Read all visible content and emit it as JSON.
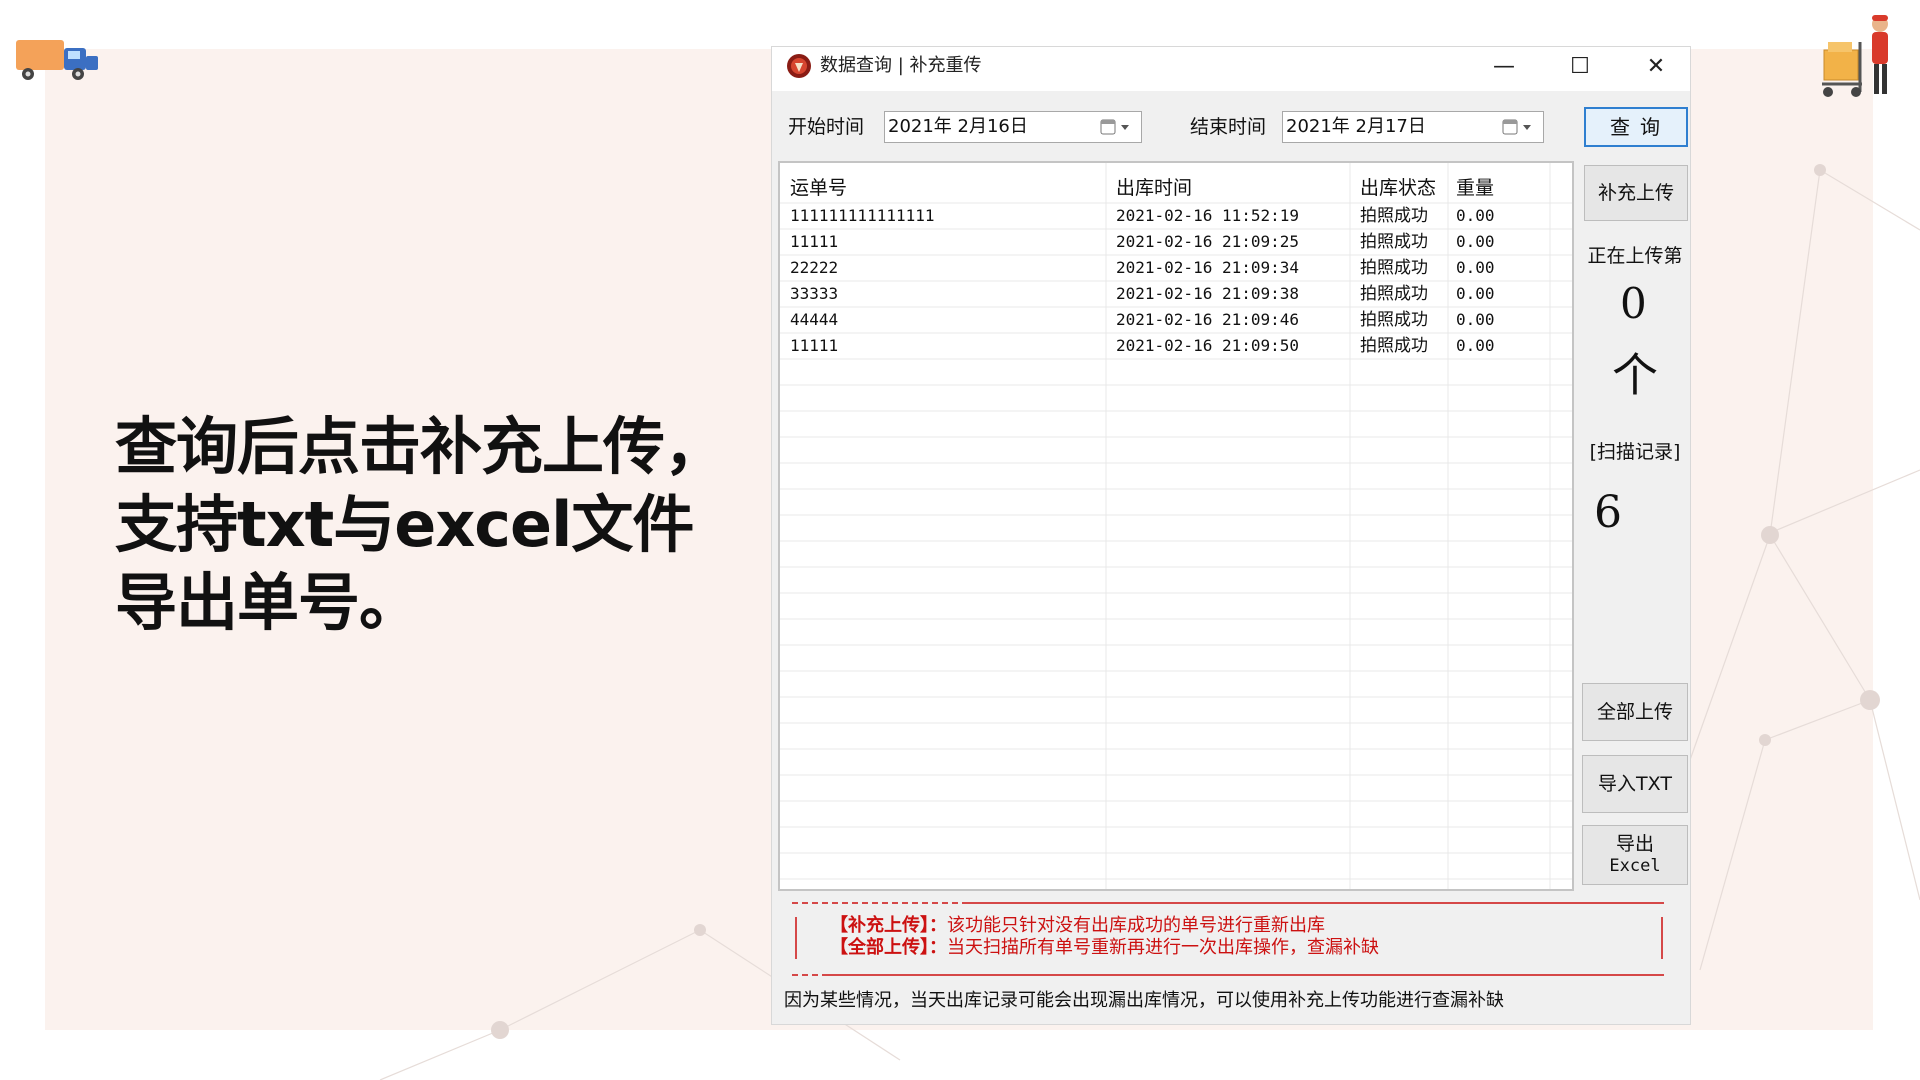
{
  "slide": {
    "heading_lines": [
      "查询后点击补充上传，",
      "支持txt与excel文件",
      "导出单号。"
    ]
  },
  "window": {
    "title": "数据查询 | 补充重传",
    "controls": {
      "minimize": "—",
      "maximize": "☐",
      "close": "✕"
    }
  },
  "filters": {
    "start_label": "开始时间",
    "start_value": "2021年 2月16日",
    "end_label": "结束时间",
    "end_value": "2021年 2月17日",
    "query_button": "查询"
  },
  "table": {
    "columns": [
      "运单号",
      "出库时间",
      "出库状态",
      "重量"
    ],
    "rows": [
      {
        "tracking": "111111111111111",
        "time": "2021-02-16 11:52:19",
        "status": "拍照成功",
        "weight": "0.00"
      },
      {
        "tracking": "11111",
        "time": "2021-02-16 21:09:25",
        "status": "拍照成功",
        "weight": "0.00"
      },
      {
        "tracking": "22222",
        "time": "2021-02-16 21:09:34",
        "status": "拍照成功",
        "weight": "0.00"
      },
      {
        "tracking": "33333",
        "time": "2021-02-16 21:09:38",
        "status": "拍照成功",
        "weight": "0.00"
      },
      {
        "tracking": "44444",
        "time": "2021-02-16 21:09:46",
        "status": "拍照成功",
        "weight": "0.00"
      },
      {
        "tracking": "11111",
        "time": "2021-02-16 21:09:50",
        "status": "拍照成功",
        "weight": "0.00"
      }
    ]
  },
  "side": {
    "supplement_button": "补充上传",
    "uploading_label": "正在上传第",
    "uploading_count": "0",
    "uploading_unit": "个",
    "scan_label": "[扫描记录]",
    "scan_count": "6",
    "upload_all_button": "全部上传",
    "import_button": "导入TXT",
    "export_button_line1": "导出",
    "export_button_line2": "Excel"
  },
  "notes": {
    "line1_tag": "【补充上传】：",
    "line1_text": "该功能只针对没有出库成功的单号进行重新出库",
    "line2_tag": "【全部上传】：",
    "line2_text": "当天扫描所有单号重新再进行一次出库操作，查漏补缺"
  },
  "footer": "因为某些情况，当天出库记录可能会出现漏出库情况，可以使用补充上传功能进行查漏补缺",
  "colors": {
    "panel_bg": "#fbf2ee",
    "note_red": "#cc1111",
    "query_border": "#2f7fd0"
  }
}
